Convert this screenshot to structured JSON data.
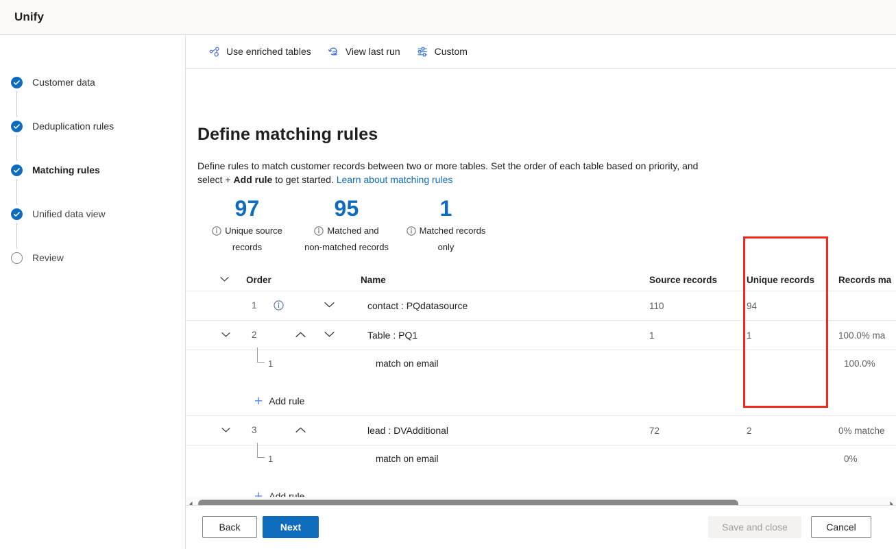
{
  "app": {
    "title": "Unify"
  },
  "wizard": {
    "steps": [
      {
        "label": "Customer data",
        "state": "done"
      },
      {
        "label": "Deduplication rules",
        "state": "done"
      },
      {
        "label": "Matching rules",
        "state": "current"
      },
      {
        "label": "Unified data view",
        "state": "done"
      },
      {
        "label": "Review",
        "state": "todo"
      }
    ]
  },
  "command_bar": {
    "buttons": [
      {
        "label": "Use enriched tables",
        "icon": "enriched-tables-icon"
      },
      {
        "label": "View last run",
        "icon": "history-icon"
      },
      {
        "label": "Custom",
        "icon": "sliders-icon"
      }
    ]
  },
  "page": {
    "title": "Define matching rules",
    "description_part1": "Define rules to match customer records between two or more tables. Set the order of each table based on priority, and select + ",
    "description_bold": "Add rule",
    "description_part2": " to get started. ",
    "description_link": "Learn about matching rules"
  },
  "kpis": [
    {
      "value": "97",
      "label_line1": "Unique source",
      "label_line2": "records"
    },
    {
      "value": "95",
      "label_line1": "Matched and",
      "label_line2": "non-matched records"
    },
    {
      "value": "1",
      "label_line1": "Matched records",
      "label_line2": "only"
    }
  ],
  "table": {
    "columns": {
      "order": "Order",
      "name": "Name",
      "source_records": "Source records",
      "unique_records": "Unique records",
      "records_matched": "Records ma"
    },
    "rows": [
      {
        "order": "1",
        "name": "contact : PQdatasource",
        "source_records": "110",
        "unique_records": "94",
        "records_matched": ""
      },
      {
        "order": "2",
        "name": "Table : PQ1",
        "source_records": "1",
        "unique_records": "1",
        "records_matched": "100.0% ma"
      },
      {
        "order": "3",
        "name": "lead : DVAdditional",
        "source_records": "72",
        "unique_records": "2",
        "records_matched": "0% matche"
      }
    ],
    "subrows": [
      {
        "num": "1",
        "name": "match on email",
        "records_matched": "100.0%"
      },
      {
        "num": "1",
        "name": "match on email",
        "records_matched": "0%"
      }
    ],
    "add_rule_label": "Add rule"
  },
  "footer": {
    "back": "Back",
    "next": "Next",
    "save_and_close": "Save and close",
    "cancel": "Cancel"
  },
  "colors": {
    "accent": "#0f6cbd",
    "highlight": "#f5281e",
    "kpi_value": "#0f6cbd"
  }
}
